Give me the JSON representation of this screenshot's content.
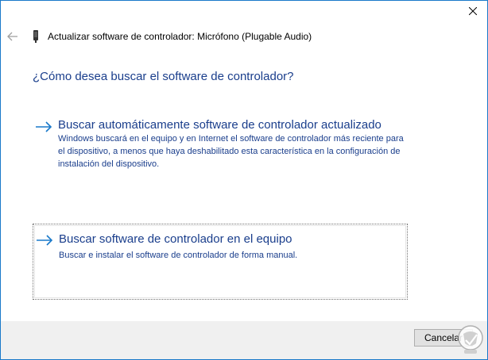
{
  "window": {
    "title": "Actualizar software de controlador: Micrófono (Plugable Audio)"
  },
  "icons": {
    "close": "close-icon",
    "back": "back-arrow-icon",
    "device": "audio-device-icon",
    "option_arrow": "right-arrow-icon"
  },
  "main": {
    "question": "¿Cómo desea buscar el software de controlador?",
    "options": [
      {
        "title": "Buscar automáticamente software de controlador actualizado",
        "description": "Windows buscará en el equipo y en Internet el software de controlador más reciente para el dispositivo, a menos que haya deshabilitado esta característica en la configuración de instalación del dispositivo."
      },
      {
        "title": "Buscar software de controlador en el equipo",
        "description": "Buscar e instalar el software de controlador de forma manual."
      }
    ]
  },
  "footer": {
    "cancel_label": "Cancelar"
  },
  "colors": {
    "link": "#1a3e8c",
    "accent_arrow": "#1979ca",
    "footer_bg": "#f0f0f0",
    "window_border": "#1979ca"
  }
}
